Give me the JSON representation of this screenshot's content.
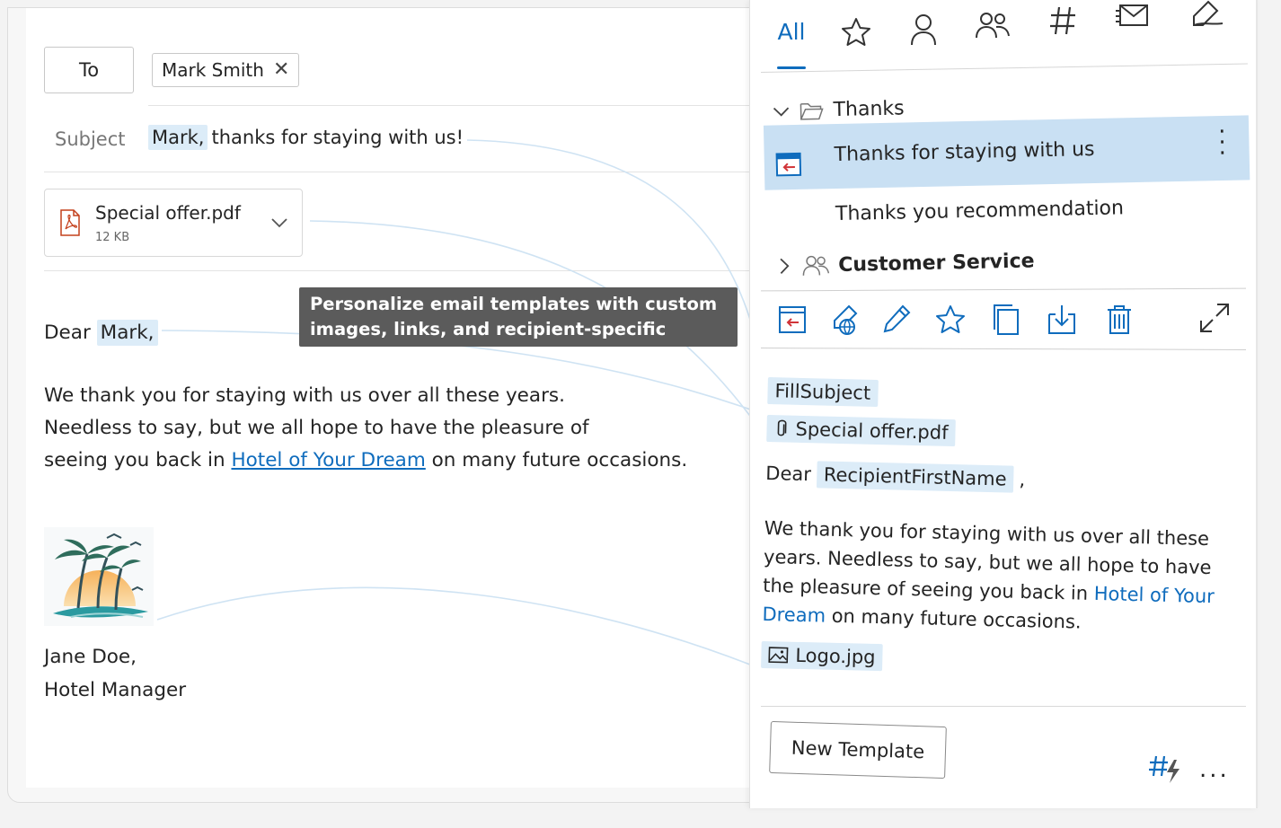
{
  "compose": {
    "to_label": "To",
    "recipient": "Mark Smith",
    "subject_label": "Subject",
    "subject_name": "Mark,",
    "subject_rest": "thanks for staying with us!",
    "attachment": {
      "name": "Special offer.pdf",
      "size": "12 KB"
    },
    "greeting_prefix": "Dear",
    "greeting_name": "Mark,",
    "body_line1": "We thank you for staying with us over all these years.",
    "body_line2": "Needless to say, but we all hope to have the pleasure of",
    "body_line3_pre": "seeing you back in",
    "body_link": "Hotel of Your Dream",
    "body_line3_post": "on many future occasions.",
    "signature_name": "Jane Doe,",
    "signature_title": "Hotel Manager"
  },
  "tooltip": {
    "line1": "Personalize email templates with custom",
    "line2": "images, links, and recipient-specific details."
  },
  "panel": {
    "tab_all": "All",
    "folders": [
      {
        "name": "Thanks",
        "items": [
          "Thanks for staying with us",
          "Thanks you recommendation"
        ]
      },
      {
        "name": "Customer Service"
      }
    ],
    "preview": {
      "subject_tag": "FillSubject",
      "attachment_tag": "Special offer.pdf",
      "greeting": "Dear",
      "recipient_tag": "RecipientFirstName",
      "comma": ",",
      "body_pre": "We thank you for staying with us over all these years. Needless to say, but we all hope to have the pleasure of seeing you back in",
      "body_link": "Hotel of Your Dream",
      "body_post": "on many future occasions.",
      "image_tag": "Logo.jpg"
    },
    "new_template_label": "New Template",
    "more_label": "..."
  },
  "colors": {
    "accent": "#0f6cbd",
    "highlight": "#dcecf8",
    "selected_row": "#c9e0f3",
    "tooltip_bg": "#5b5b5b"
  }
}
